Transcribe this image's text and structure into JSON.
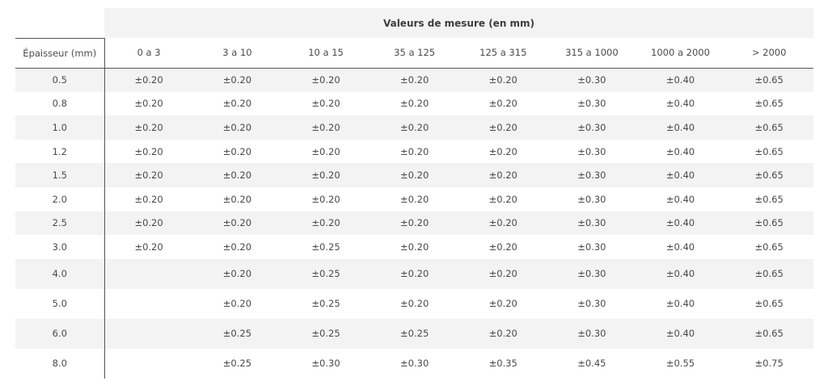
{
  "table": {
    "group_header": "Valeurs de mesure (en mm)",
    "row_header": "Épaisseur (mm)",
    "columns": [
      "0 a 3",
      "3 a 10",
      "10 a 15",
      "35 a 125",
      "125 a 315",
      "315 a 1000",
      "1000 a 2000",
      "> 2000"
    ],
    "rows": [
      {
        "thickness": "0.5",
        "values": [
          "±0.20",
          "±0.20",
          "±0.20",
          "±0.20",
          "±0.20",
          "±0.30",
          "±0.40",
          "±0.65"
        ]
      },
      {
        "thickness": "0.8",
        "values": [
          "±0.20",
          "±0.20",
          "±0.20",
          "±0.20",
          "±0.20",
          "±0.30",
          "±0.40",
          "±0.65"
        ]
      },
      {
        "thickness": "1.0",
        "values": [
          "±0.20",
          "±0.20",
          "±0.20",
          "±0.20",
          "±0.20",
          "±0.30",
          "±0.40",
          "±0.65"
        ]
      },
      {
        "thickness": "1.2",
        "values": [
          "±0.20",
          "±0.20",
          "±0.20",
          "±0.20",
          "±0.20",
          "±0.30",
          "±0.40",
          "±0.65"
        ]
      },
      {
        "thickness": "1.5",
        "values": [
          "±0.20",
          "±0.20",
          "±0.20",
          "±0.20",
          "±0.20",
          "±0.30",
          "±0.40",
          "±0.65"
        ]
      },
      {
        "thickness": "2.0",
        "values": [
          "±0.20",
          "±0.20",
          "±0.20",
          "±0.20",
          "±0.20",
          "±0.30",
          "±0.40",
          "±0.65"
        ]
      },
      {
        "thickness": "2.5",
        "values": [
          "±0.20",
          "±0.20",
          "±0.20",
          "±0.20",
          "±0.20",
          "±0.30",
          "±0.40",
          "±0.65"
        ]
      },
      {
        "thickness": "3.0",
        "values": [
          "±0.20",
          "±0.20",
          "±0.25",
          "±0.20",
          "±0.20",
          "±0.30",
          "±0.40",
          "±0.65"
        ]
      },
      {
        "thickness": "4.0",
        "values": [
          "",
          "±0.20",
          "±0.25",
          "±0.20",
          "±0.20",
          "±0.30",
          "±0.40",
          "±0.65"
        ]
      },
      {
        "thickness": "5.0",
        "values": [
          "",
          "±0.20",
          "±0.25",
          "±0.20",
          "±0.20",
          "±0.30",
          "±0.40",
          "±0.65"
        ]
      },
      {
        "thickness": "6.0",
        "values": [
          "",
          "±0.25",
          "±0.25",
          "±0.25",
          "±0.20",
          "±0.30",
          "±0.40",
          "±0.65"
        ]
      },
      {
        "thickness": "8.0",
        "values": [
          "",
          "±0.25",
          "±0.30",
          "±0.30",
          "±0.35",
          "±0.45",
          "±0.55",
          "±0.75"
        ]
      }
    ]
  }
}
